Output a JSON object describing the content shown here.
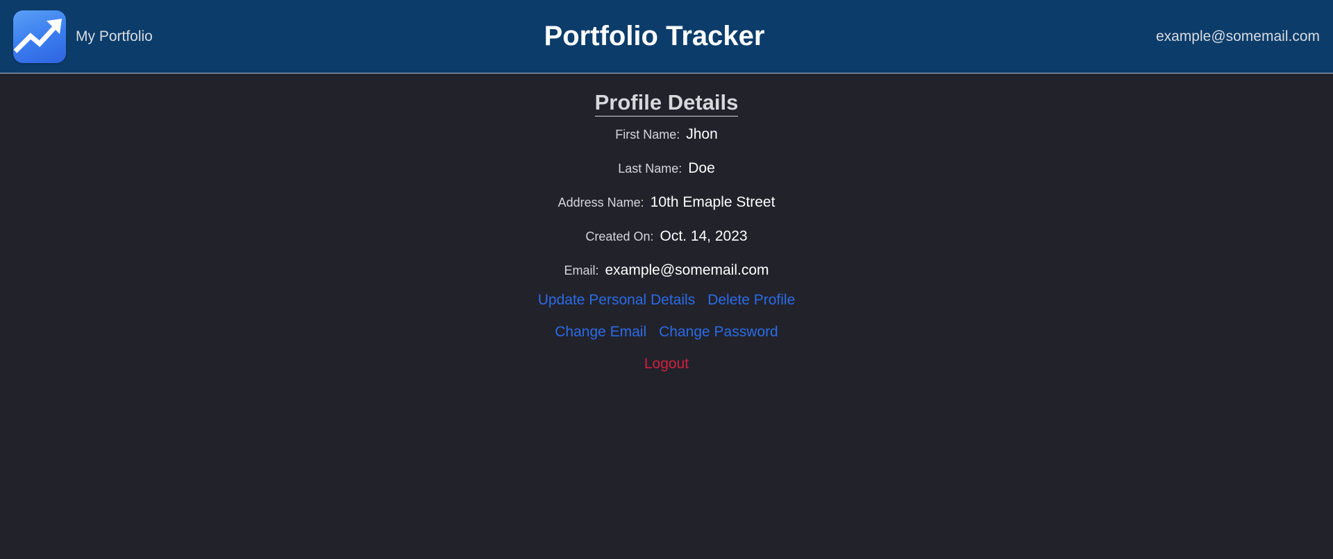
{
  "header": {
    "brand_label": "My Portfolio",
    "title": "Portfolio Tracker",
    "user_email": "example@somemail.com",
    "logo_icon": "trending-up-icon"
  },
  "profile": {
    "heading": "Profile Details",
    "fields": [
      {
        "label": "First Name:",
        "value": "Jhon"
      },
      {
        "label": "Last Name:",
        "value": "Doe"
      },
      {
        "label": "Address Name:",
        "value": "10th Emaple Street"
      },
      {
        "label": "Created On:",
        "value": "Oct. 14, 2023"
      },
      {
        "label": "Email:",
        "value": "example@somemail.com"
      }
    ],
    "actions": {
      "update_details": "Update Personal Details",
      "delete_profile": "Delete Profile",
      "change_email": "Change Email",
      "change_password": "Change Password",
      "logout": "Logout"
    }
  },
  "colors": {
    "header_bg": "#0c3c6a",
    "page_bg": "#22222b",
    "link": "#2b6ce6",
    "logout": "#d21f3c"
  }
}
